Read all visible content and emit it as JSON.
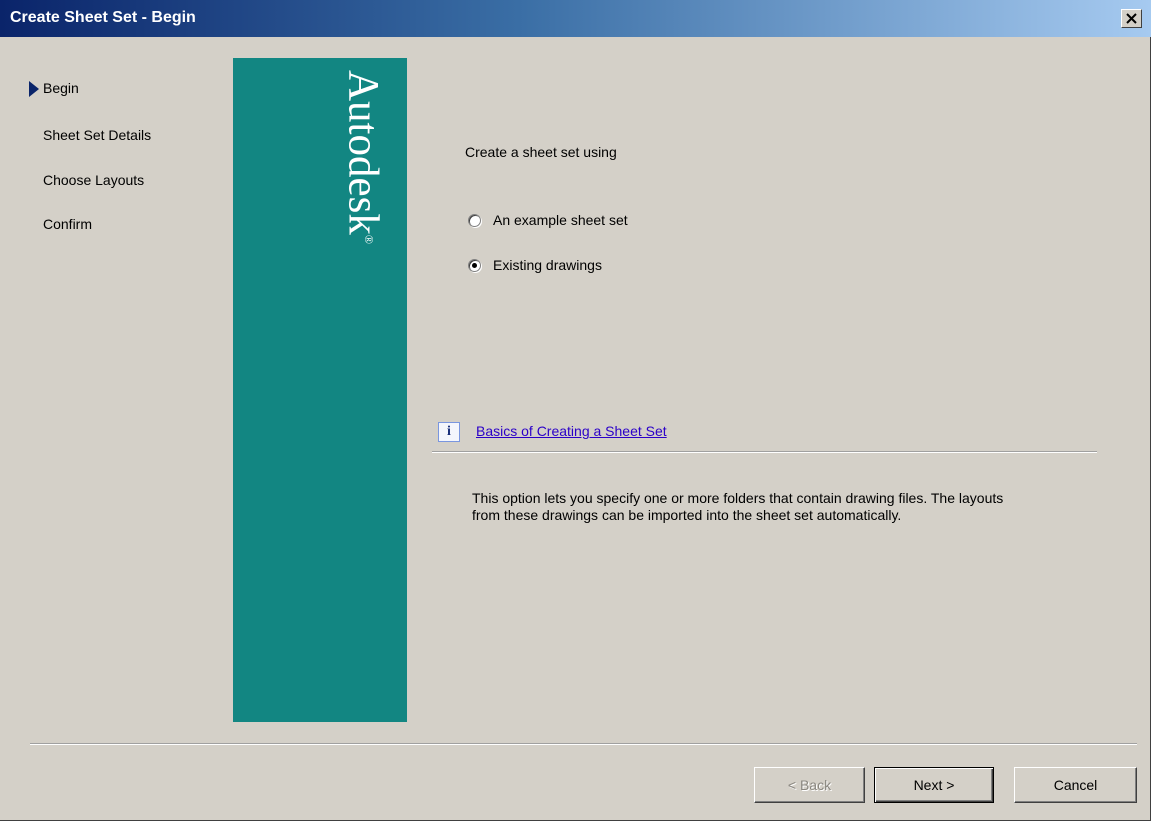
{
  "window": {
    "title": "Create Sheet Set - Begin",
    "close_icon": "close-icon"
  },
  "steps": [
    {
      "label": "Begin",
      "current": true
    },
    {
      "label": "Sheet Set Details",
      "current": false
    },
    {
      "label": "Choose Layouts",
      "current": false
    },
    {
      "label": "Confirm",
      "current": false
    }
  ],
  "banner": {
    "brand": "Autodesk",
    "trademark": "®",
    "color": "#128682"
  },
  "main": {
    "prompt": "Create a sheet set using",
    "options": [
      {
        "label": "An example sheet set",
        "selected": false
      },
      {
        "label": "Existing drawings",
        "selected": true
      }
    ],
    "help_link": "Basics of Creating a Sheet Set",
    "info_icon": "i",
    "description": "This option lets you specify one or more folders that contain drawing files.  The layouts from these drawings can be imported into the sheet set automatically."
  },
  "buttons": {
    "back": "< Back",
    "next": "Next >",
    "cancel": "Cancel"
  },
  "colors": {
    "face": "#d4d0c8",
    "title_start": "#0a246a",
    "title_end": "#a6caf0",
    "link": "#2b00c8"
  }
}
